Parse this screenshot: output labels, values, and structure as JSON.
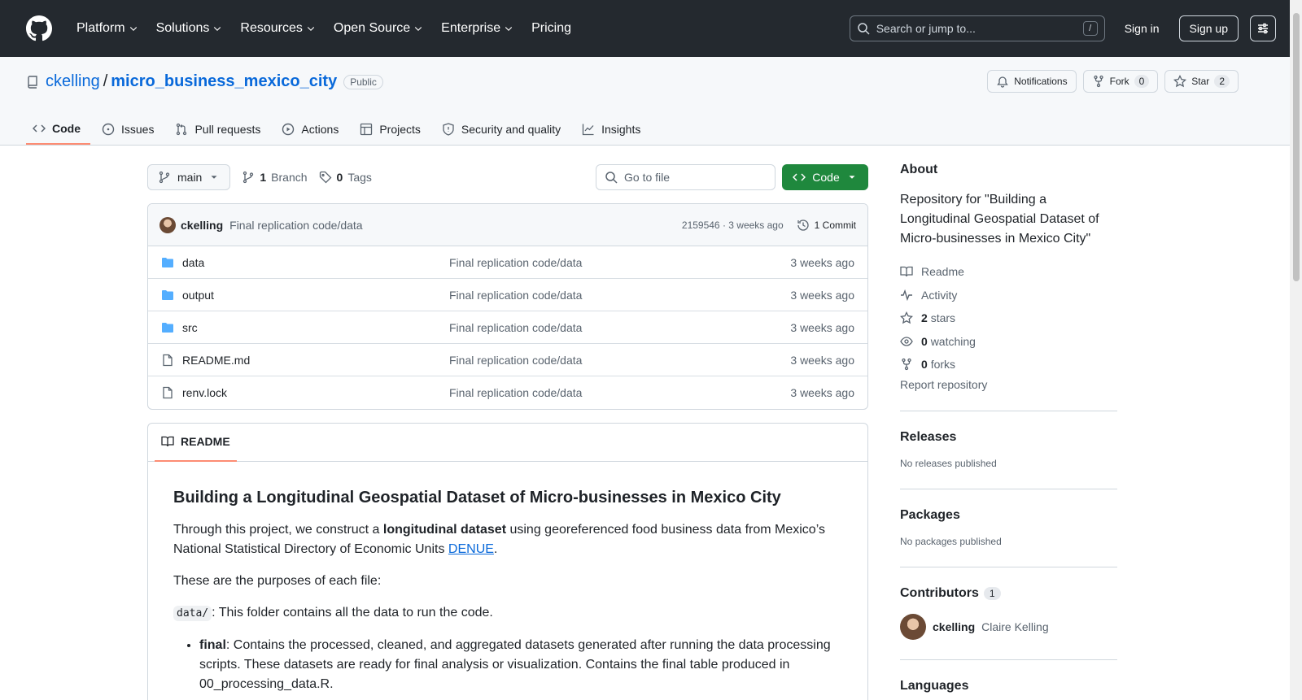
{
  "header": {
    "nav": [
      "Platform",
      "Solutions",
      "Resources",
      "Open Source",
      "Enterprise",
      "Pricing"
    ],
    "search_placeholder": "Search or jump to...",
    "search_shortcut": "/",
    "sign_in": "Sign in",
    "sign_up": "Sign up"
  },
  "repo": {
    "owner": "ckelling",
    "name": "micro_business_mexico_city",
    "visibility": "Public",
    "notifications_label": "Notifications",
    "fork_label": "Fork",
    "fork_count": "0",
    "star_label": "Star",
    "star_count": "2"
  },
  "tabs": [
    "Code",
    "Issues",
    "Pull requests",
    "Actions",
    "Projects",
    "Security and quality",
    "Insights"
  ],
  "toolbar": {
    "branch": "main",
    "branch_count": "1",
    "branch_label": "Branch",
    "tag_count": "0",
    "tag_label": "Tags",
    "goto_placeholder": "Go to file",
    "code_button": "Code"
  },
  "commit": {
    "author": "ckelling",
    "message": "Final replication code/data",
    "hash_time": "2159546 · 3 weeks ago",
    "count": "1 Commit"
  },
  "files": [
    {
      "type": "folder",
      "name": "data",
      "message": "Final replication code/data",
      "time": "3 weeks ago"
    },
    {
      "type": "folder",
      "name": "output",
      "message": "Final replication code/data",
      "time": "3 weeks ago"
    },
    {
      "type": "folder",
      "name": "src",
      "message": "Final replication code/data",
      "time": "3 weeks ago"
    },
    {
      "type": "file",
      "name": "README.md",
      "message": "Final replication code/data",
      "time": "3 weeks ago"
    },
    {
      "type": "file",
      "name": "renv.lock",
      "message": "Final replication code/data",
      "time": "3 weeks ago"
    }
  ],
  "readme": {
    "tab": "README",
    "title": "Building a Longitudinal Geospatial Dataset of Micro-businesses in Mexico City",
    "p1_a": "Through this project, we construct a ",
    "p1_bold": "longitudinal dataset",
    "p1_b": " using georeferenced food business data from Mexico’s National Statistical Directory of Economic Units ",
    "p1_link": "DENUE",
    "p1_c": ".",
    "p2": "These are the purposes of each file:",
    "p3_code": "data/",
    "p3_text": ": This folder contains all the data to run the code.",
    "li1_bold": "final",
    "li1_text": ": Contains the processed, cleaned, and aggregated datasets generated after running the data processing scripts. These datasets are ready for final analysis or visualization. Contains the final table produced in 00_processing_data.R."
  },
  "sidebar": {
    "about_title": "About",
    "description": "Repository for \"Building a Longitudinal Geospatial Dataset of Micro-businesses in Mexico City\"",
    "readme": "Readme",
    "activity": "Activity",
    "stars_count": "2",
    "stars_label": "stars",
    "watching_count": "0",
    "watching_label": "watching",
    "forks_count": "0",
    "forks_label": "forks",
    "report": "Report repository",
    "releases_title": "Releases",
    "releases_text": "No releases published",
    "packages_title": "Packages",
    "packages_text": "No packages published",
    "contributors_title": "Contributors",
    "contributors_count": "1",
    "contributor_login": "ckelling",
    "contributor_name": "Claire Kelling",
    "languages_title": "Languages"
  },
  "colors": {
    "header_bg": "#24292f",
    "link": "#0969da",
    "code_button": "#1f883d",
    "active_tab_underline": "#fd8c73",
    "folder": "#54aeff"
  }
}
